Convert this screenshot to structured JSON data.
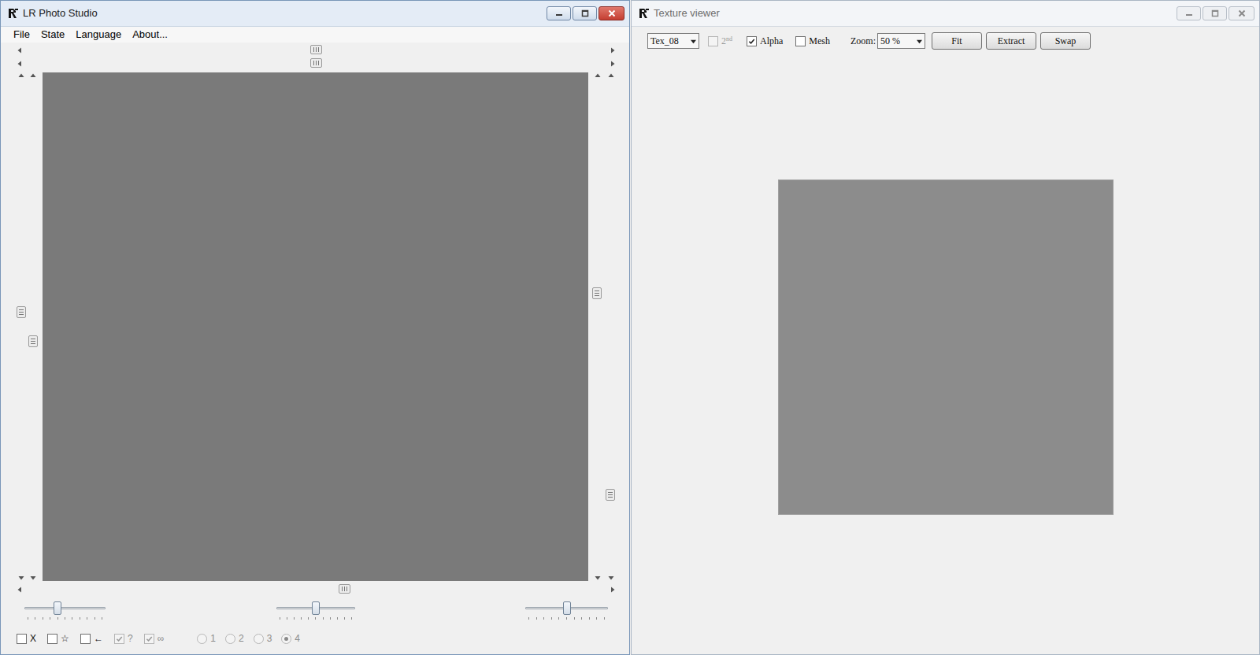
{
  "main_window": {
    "title": "LR Photo Studio",
    "active": true,
    "menu": [
      {
        "label": "File"
      },
      {
        "label": "State"
      },
      {
        "label": "Language"
      },
      {
        "label": "About..."
      }
    ],
    "top_scrollbars": [
      {
        "level": 0.5
      },
      {
        "level": 0.5
      }
    ],
    "left_scrollbars": [
      {
        "level": 0.47
      },
      {
        "level": 0.53
      }
    ],
    "right_scrollbars": [
      {
        "level": 0.43
      },
      {
        "level": 0.85
      }
    ],
    "bottom_scrollbar": {
      "level": 0.55
    },
    "sliders": [
      {
        "level": 0.4
      },
      {
        "level": 0.5
      },
      {
        "level": 0.5
      }
    ],
    "options": [
      {
        "kind": "checkbox",
        "label": "X",
        "checked": false,
        "disabled": false
      },
      {
        "kind": "checkbox",
        "label": "☆",
        "checked": false,
        "disabled": false
      },
      {
        "kind": "checkbox",
        "label": "←",
        "checked": false,
        "disabled": false
      },
      {
        "kind": "checkbox",
        "label": "?",
        "checked": true,
        "disabled": true
      },
      {
        "kind": "checkbox",
        "label": "∞",
        "checked": true,
        "disabled": true
      },
      {
        "kind": "radio",
        "label": "1",
        "selected": false,
        "disabled": true
      },
      {
        "kind": "radio",
        "label": "2",
        "selected": false,
        "disabled": true
      },
      {
        "kind": "radio",
        "label": "3",
        "selected": false,
        "disabled": true
      },
      {
        "kind": "radio",
        "label": "4",
        "selected": true,
        "disabled": true
      }
    ]
  },
  "texture_window": {
    "title": "Texture viewer",
    "active": false,
    "texture_select": "Tex_08",
    "second": {
      "label": "2",
      "superscript": "nd",
      "checked": false,
      "disabled": true
    },
    "alpha": {
      "label": "Alpha",
      "checked": true,
      "disabled": false
    },
    "mesh": {
      "label": "Mesh",
      "checked": false,
      "disabled": false
    },
    "zoom_label": "Zoom:",
    "zoom": "50 %",
    "buttons": [
      {
        "label": "Fit"
      },
      {
        "label": "Extract"
      },
      {
        "label": "Swap"
      }
    ]
  }
}
